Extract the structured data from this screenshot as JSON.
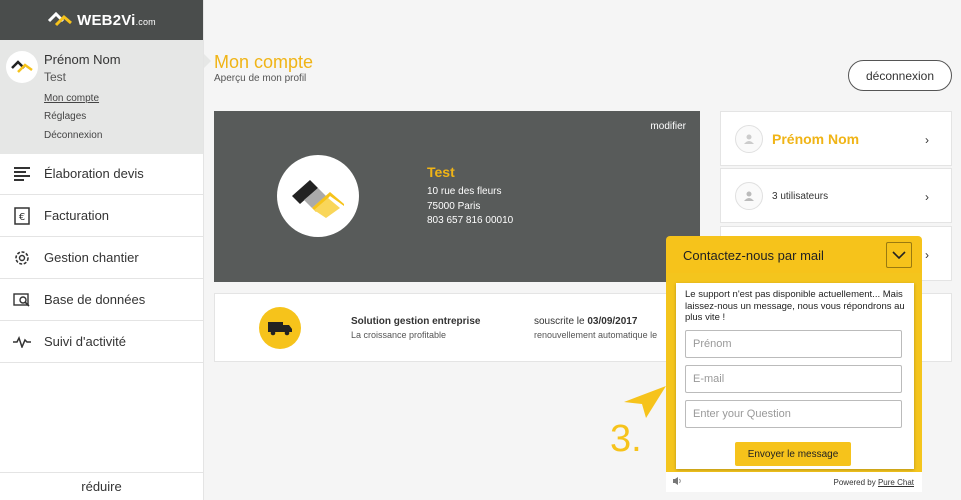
{
  "brand": {
    "name": "WEB2Vi",
    "suffix": ".com"
  },
  "profile": {
    "name": "Prénom Nom",
    "subtitle": "Test",
    "links": [
      "Mon compte",
      "Réglages",
      "Déconnexion"
    ]
  },
  "nav": [
    {
      "label": "Élaboration devis",
      "icon": "list-lines-icon"
    },
    {
      "label": "Facturation",
      "icon": "invoice-euro-icon"
    },
    {
      "label": "Gestion chantier",
      "icon": "gear-icon"
    },
    {
      "label": "Base de données",
      "icon": "database-search-icon"
    },
    {
      "label": "Suivi d'activité",
      "icon": "activity-pulse-icon"
    }
  ],
  "sidebar_collapse": "réduire",
  "header": {
    "title": "Mon compte",
    "subtitle": "Aperçu de mon profil",
    "logout": "déconnexion"
  },
  "company": {
    "edit": "modifier",
    "name": "Test",
    "address1": "10 rue des fleurs",
    "address2": "75000 Paris",
    "id": "803 657 816 00010"
  },
  "subscription": {
    "title": "Solution gestion entreprise",
    "tagline": "La croissance profitable",
    "subscribed_prefix": "souscrite le ",
    "subscribed_date": "03/09/2017",
    "renewal": "renouvellement automatique le"
  },
  "side_cards": {
    "user_name": "Prénom Nom",
    "users": "3 utilisateurs"
  },
  "chat": {
    "title": "Contactez-nous par mail",
    "message": "Le support n'est pas disponible actuellement... Mais laissez-nous un message, nous vous répondrons au plus vite !",
    "placeholders": {
      "name": "Prénom",
      "email": "E-mail",
      "question": "Enter your Question"
    },
    "send": "Envoyer le message",
    "powered_prefix": "Powered by ",
    "powered_brand": "Pure Chat"
  },
  "annotation": {
    "step": "3."
  },
  "colors": {
    "accent": "#f6c31b",
    "title": "#f0b416",
    "card_dark": "#585b5a",
    "sidebar_header": "#4a4d4c"
  }
}
